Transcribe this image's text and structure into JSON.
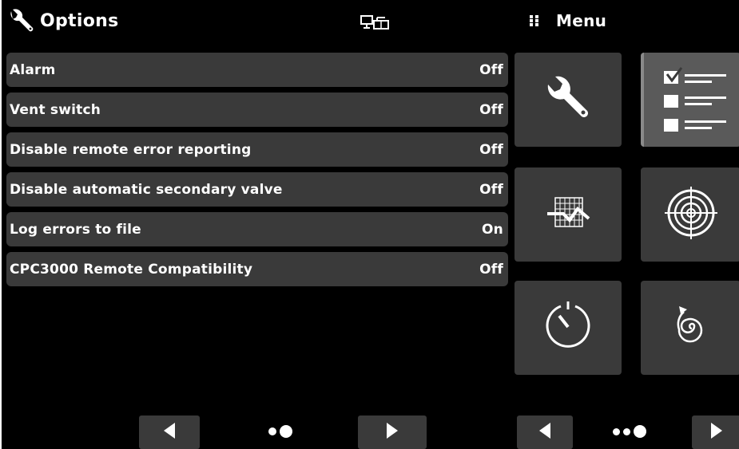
{
  "header": {
    "title": "Options",
    "title_icon": "wrench-icon",
    "network_icon": "network-icon",
    "menu_label": "Menu",
    "menu_icon": "grid-dots-icon"
  },
  "options": [
    {
      "label": "Alarm",
      "value": "Off"
    },
    {
      "label": "Vent switch",
      "value": "Off"
    },
    {
      "label": "Disable remote error reporting",
      "value": "Off"
    },
    {
      "label": "Disable automatic secondary valve",
      "value": "Off"
    },
    {
      "label": "Log errors to file",
      "value": "On"
    },
    {
      "label": "CPC3000 Remote Compatibility",
      "value": "Off"
    }
  ],
  "menu_tiles": [
    {
      "icon": "wrench-icon",
      "selected": false
    },
    {
      "icon": "checklist-icon",
      "selected": true
    },
    {
      "icon": "chart-icon",
      "selected": false
    },
    {
      "icon": "target-icon",
      "selected": false
    },
    {
      "icon": "timer-icon",
      "selected": false
    },
    {
      "icon": "spiral-icon",
      "selected": false
    }
  ],
  "pagination": {
    "left_pages": 2,
    "left_current": 2,
    "right_pages": 3,
    "right_current": 3
  },
  "colors": {
    "background": "#000000",
    "row": "#3a3a3a",
    "tile": "#3a3a3a",
    "tile_selected": "#5a5a5a",
    "text": "#ffffff"
  }
}
